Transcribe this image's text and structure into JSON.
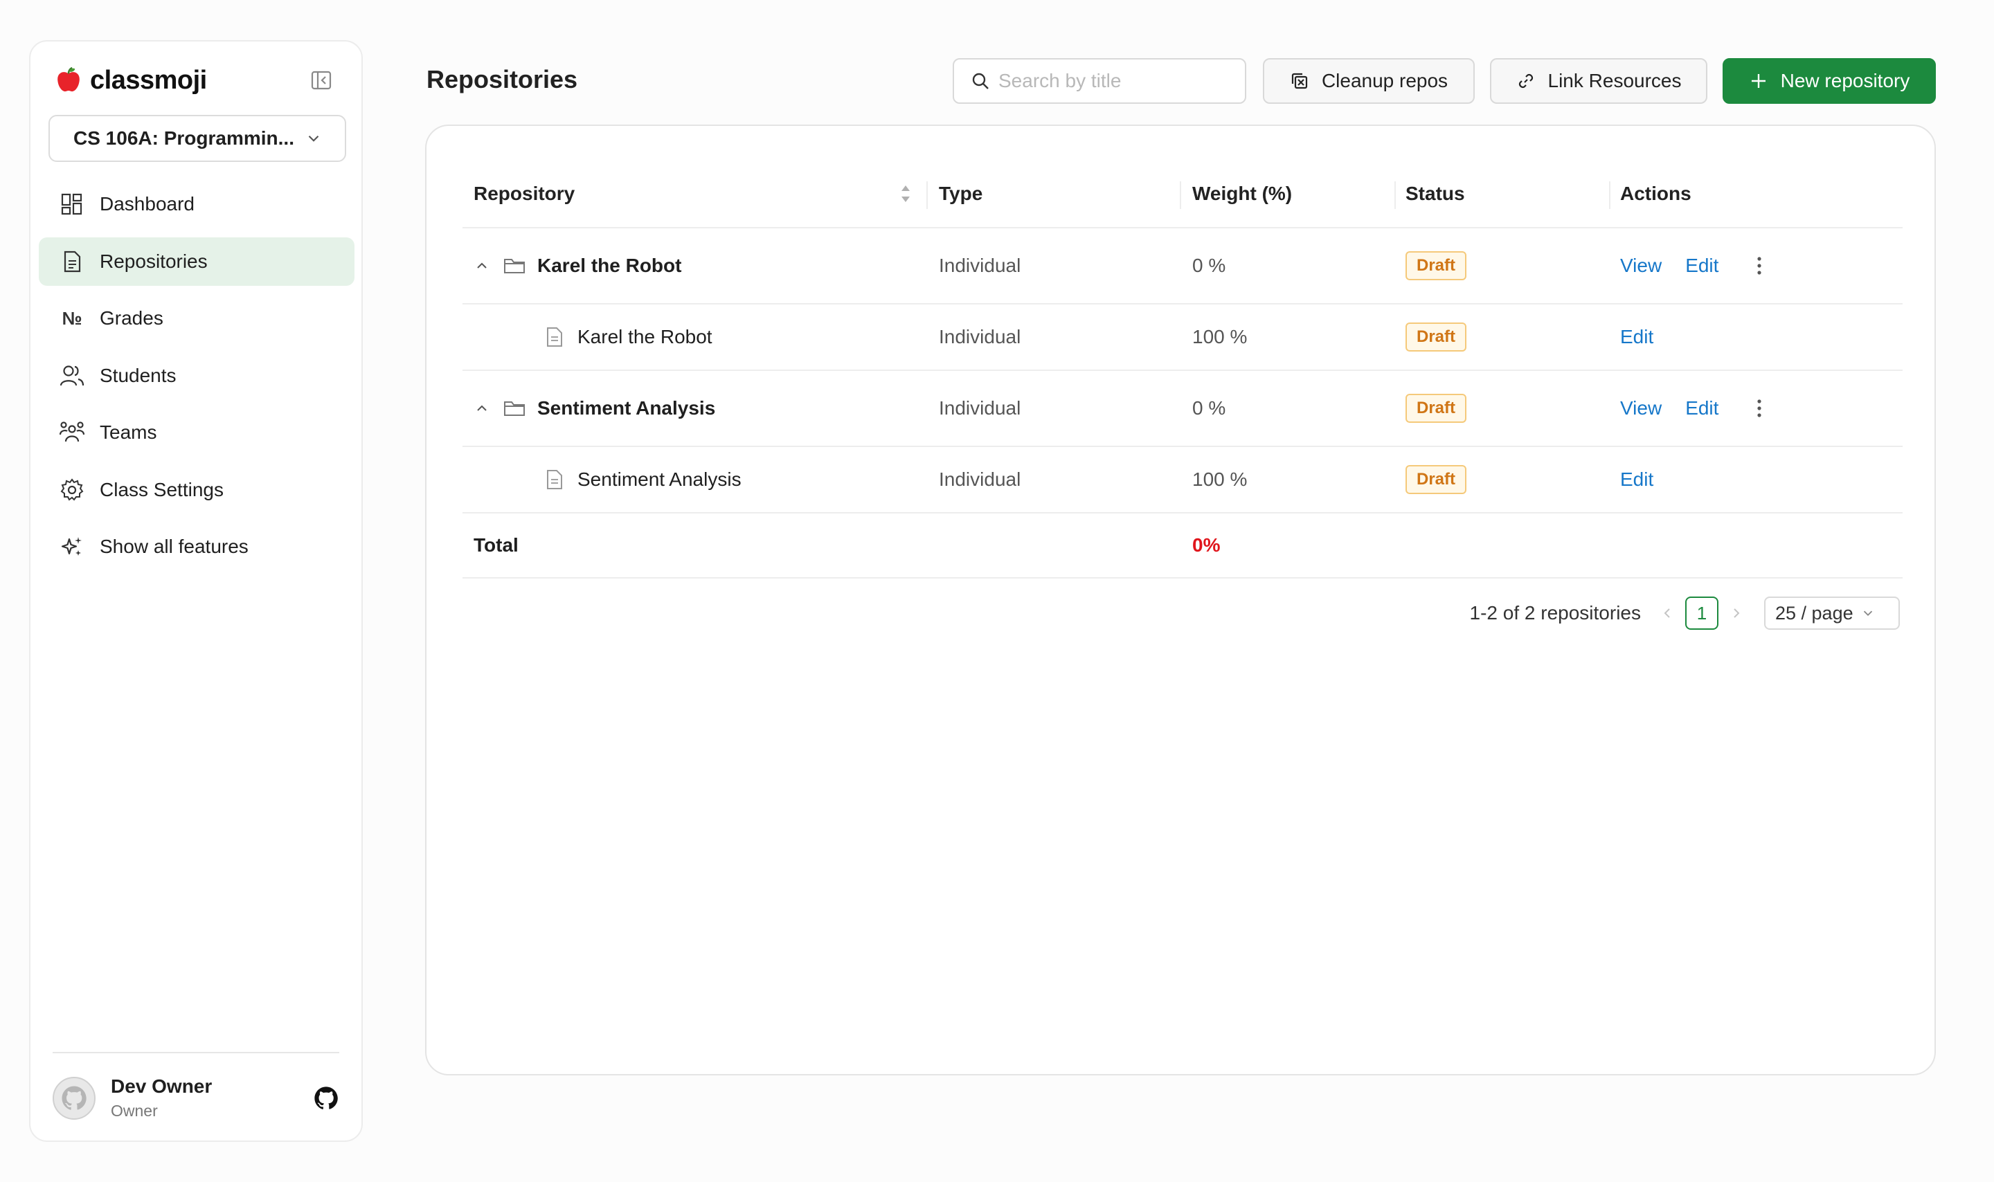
{
  "app": {
    "name": "classmoji"
  },
  "class_selector": {
    "value": "CS 106A: Programmin..."
  },
  "sidebar": {
    "items": [
      {
        "label": "Dashboard",
        "icon": "dashboard-icon",
        "active": false
      },
      {
        "label": "Repositories",
        "icon": "document-icon",
        "active": true
      },
      {
        "label": "Grades",
        "icon": "numero-icon",
        "active": false
      },
      {
        "label": "Students",
        "icon": "users-icon",
        "active": false
      },
      {
        "label": "Teams",
        "icon": "team-icon",
        "active": false
      },
      {
        "label": "Class Settings",
        "icon": "gear-icon",
        "active": false
      },
      {
        "label": "Show all features",
        "icon": "sparkles-icon",
        "active": false
      }
    ]
  },
  "user": {
    "name": "Dev Owner",
    "role": "Owner"
  },
  "header": {
    "title": "Repositories",
    "search_placeholder": "Search by title",
    "cleanup_label": "Cleanup repos",
    "link_label": "Link Resources",
    "new_label": "New repository"
  },
  "table": {
    "columns": [
      "Repository",
      "Type",
      "Weight (%)",
      "Status",
      "Actions"
    ],
    "rows": [
      {
        "kind": "parent",
        "name": "Karel the Robot",
        "type": "Individual",
        "weight": "0 %",
        "status": "Draft",
        "view": "View",
        "edit": "Edit"
      },
      {
        "kind": "child",
        "name": "Karel the Robot",
        "type": "Individual",
        "weight": "100 %",
        "status": "Draft",
        "edit": "Edit"
      },
      {
        "kind": "parent",
        "name": "Sentiment Analysis",
        "type": "Individual",
        "weight": "0 %",
        "status": "Draft",
        "view": "View",
        "edit": "Edit"
      },
      {
        "kind": "child",
        "name": "Sentiment Analysis",
        "type": "Individual",
        "weight": "100 %",
        "status": "Draft",
        "edit": "Edit"
      }
    ],
    "total": {
      "label": "Total",
      "value": "0%"
    }
  },
  "pagination": {
    "summary": "1-2 of 2 repositories",
    "current_page": "1",
    "page_size": "25 / page"
  },
  "colors": {
    "brand_green": "#1c8a3e",
    "active_nav_bg": "#e5f2e8",
    "draft_text": "#d07616",
    "link_blue": "#1677c9",
    "total_red": "#e0151c"
  }
}
